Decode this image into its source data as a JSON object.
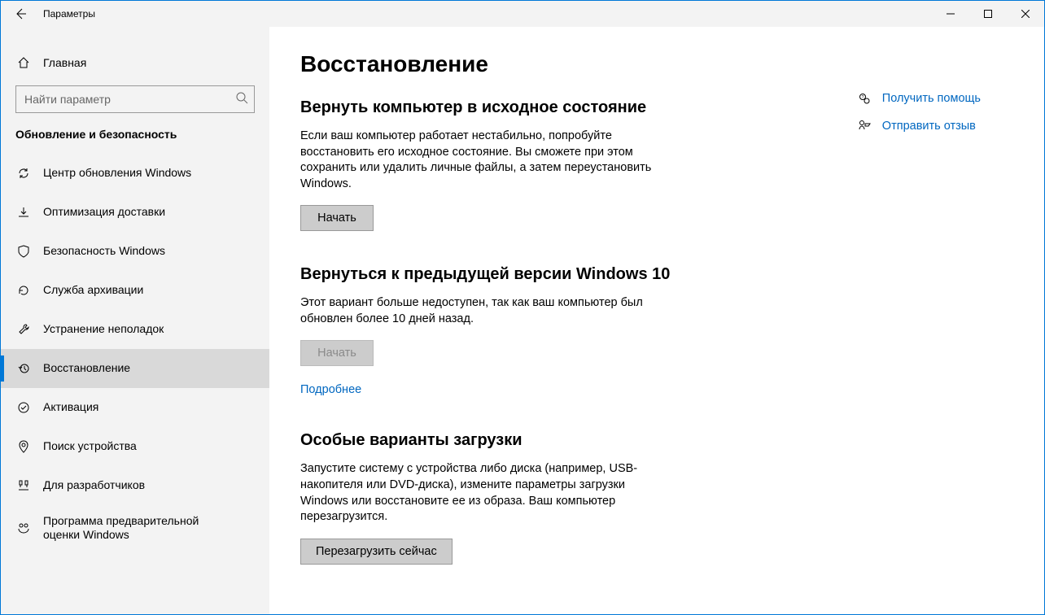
{
  "window": {
    "title": "Параметры"
  },
  "sidebar": {
    "home": "Главная",
    "search_placeholder": "Найти параметр",
    "group": "Обновление и безопасность",
    "items": [
      {
        "label": "Центр обновления Windows"
      },
      {
        "label": "Оптимизация доставки"
      },
      {
        "label": "Безопасность Windows"
      },
      {
        "label": "Служба архивации"
      },
      {
        "label": "Устранение неполадок"
      },
      {
        "label": "Восстановление"
      },
      {
        "label": "Активация"
      },
      {
        "label": "Поиск устройства"
      },
      {
        "label": "Для разработчиков"
      },
      {
        "label": "Программа предварительной оценки Windows"
      }
    ]
  },
  "page": {
    "title": "Восстановление",
    "sections": {
      "reset": {
        "title": "Вернуть компьютер в исходное состояние",
        "text": "Если ваш компьютер работает нестабильно, попробуйте восстановить его исходное состояние. Вы сможете при этом сохранить или удалить личные файлы, а затем переустановить Windows.",
        "button": "Начать"
      },
      "goback": {
        "title": "Вернуться к предыдущей версии Windows 10",
        "text": "Этот вариант больше недоступен, так как ваш компьютер был обновлен более 10 дней назад.",
        "button": "Начать",
        "link": "Подробнее"
      },
      "advanced": {
        "title": "Особые варианты загрузки",
        "text": "Запустите систему с устройства либо диска (например, USB-накопителя или DVD-диска), измените параметры загрузки Windows или восстановите ее из образа. Ваш компьютер перезагрузится.",
        "button": "Перезагрузить сейчас"
      }
    }
  },
  "right": {
    "help": "Получить помощь",
    "feedback": "Отправить отзыв"
  }
}
